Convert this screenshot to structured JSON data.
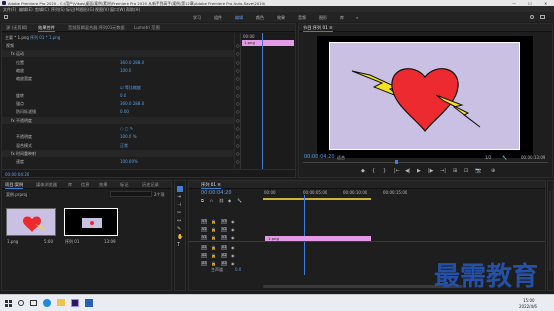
{
  "window": {
    "title": "Adobe Premiere Pro 2020 - C:\\用户\\Vikas\\桌面\\案例\\素材\\Premiere Pro 2020 从新手到高手\\案例\\第12章\\Adobe Premiere Pro Auto-Save\\2020\\",
    "controls": [
      "—",
      "☐",
      "✕"
    ]
  },
  "menu": [
    "文件(F)",
    "编辑(E)",
    "剪辑(C)",
    "序列(S)",
    "标记(M)",
    "图形(G)",
    "视图(V)",
    "窗口(W)",
    "帮助(H)"
  ],
  "workspaces": [
    "学习",
    "组件",
    "编辑",
    "颜色",
    "效果",
    "音频",
    "图形",
    "库",
    "»"
  ],
  "source_panel": {
    "tabs": [
      "源:(无剪辑)",
      "效果控件",
      "音频剪辑混合器:序列01",
      "元数据",
      "Lumetri 范围"
    ],
    "active_tab": 1,
    "clip_label": "主要 * 1.png",
    "seq_label": "序列 01 * 1.png",
    "time_ruler": "00:00",
    "clip_block": "1.png",
    "rows": [
      {
        "label": "视频",
        "value": "",
        "indent": 0
      },
      {
        "label": "fx 运动",
        "value": "",
        "indent": 1
      },
      {
        "label": "位置",
        "value": "360.0   288.0",
        "indent": 2
      },
      {
        "label": "缩放",
        "value": "100.0",
        "indent": 2
      },
      {
        "label": "缩放宽度",
        "value": "",
        "indent": 2
      },
      {
        "label": "",
        "value": "☑ 等比缩放",
        "indent": 2
      },
      {
        "label": "旋转",
        "value": "0.0",
        "indent": 2
      },
      {
        "label": "锚点",
        "value": "360.0   288.0",
        "indent": 2
      },
      {
        "label": "防闪烁滤镜",
        "value": "0.00",
        "indent": 2
      },
      {
        "label": "fx 不透明度",
        "value": "",
        "indent": 1
      },
      {
        "label": "",
        "value": "○ □ ✎",
        "indent": 2
      },
      {
        "label": "不透明度",
        "value": "100.0 %",
        "indent": 2
      },
      {
        "label": "混合模式",
        "value": "正常",
        "indent": 2
      },
      {
        "label": "fx 时间重映射",
        "value": "",
        "indent": 1
      },
      {
        "label": "速度",
        "value": "100.00%",
        "indent": 2
      }
    ],
    "timecode": "00:00:04:20"
  },
  "program_monitor": {
    "title": "节目:序列 01 ≡",
    "timecode": "00:00:04:20",
    "fit": "适合",
    "quality": "1/2",
    "duration": "00:00:13:09",
    "transport": [
      "◆",
      "{",
      "}",
      "|←",
      "◀|",
      "▶",
      "|▶",
      "→|",
      "⊞",
      "⊡",
      "📷",
      "⊕"
    ]
  },
  "project_panel": {
    "tabs": [
      "项目:案例",
      "媒体浏览器",
      "库",
      "信息",
      "效果",
      "标记",
      "历史记录"
    ],
    "path": "案例.prproj",
    "search": "",
    "count": "2个项",
    "items": [
      {
        "name": "1.png",
        "duration": "5:00"
      },
      {
        "name": "序列 01",
        "duration": "13:09"
      }
    ]
  },
  "timeline": {
    "tab": "序列 01 ≡",
    "timecode": "00:00:04:20",
    "ruler": [
      "00:00",
      "00:00:05:00",
      "00:00:10:00",
      "00:00:15:00"
    ],
    "video_tracks": [
      "V3",
      "V2",
      "V1"
    ],
    "audio_tracks": [
      "A1",
      "A2",
      "A3"
    ],
    "master": "主声道",
    "master_value": "0.0",
    "clip": "1.png"
  },
  "taskbar": {
    "time": "15:00",
    "date": "2022/4/6"
  },
  "watermark": "最需教育"
}
